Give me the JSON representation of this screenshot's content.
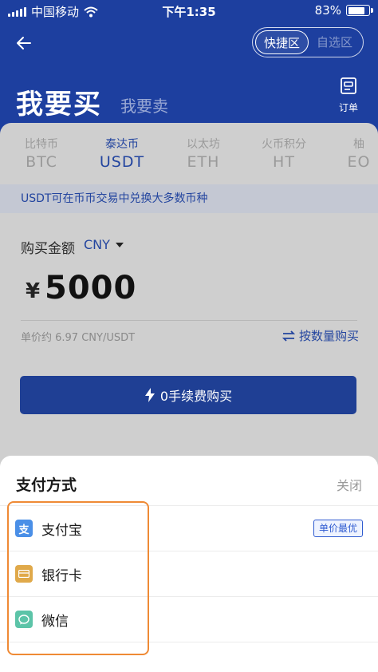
{
  "status_bar": {
    "carrier": "中国移动",
    "time": "下午1:35",
    "battery": "83%"
  },
  "header": {
    "toggle": {
      "active": "快捷区",
      "inactive": "自选区"
    },
    "buy_title": "我要买",
    "sell_title": "我要卖",
    "orders_label": "订单"
  },
  "tabs": [
    {
      "cn": "比特币",
      "code": "BTC"
    },
    {
      "cn": "泰达币",
      "code": "USDT"
    },
    {
      "cn": "以太坊",
      "code": "ETH"
    },
    {
      "cn": "火币积分",
      "code": "HT"
    },
    {
      "cn": "柚",
      "code": "EO"
    }
  ],
  "info_text": "USDT可在币币交易中兑换大多数币种",
  "purchase": {
    "amount_label": "购买金额",
    "currency": "CNY",
    "yen_symbol": "¥",
    "amount": "5000",
    "unit_price": "单价约 6.97 CNY/USDT",
    "by_quantity": "按数量购买",
    "buy_button": "0手续费购买"
  },
  "payment_sheet": {
    "title": "支付方式",
    "close": "关闭",
    "methods": [
      {
        "name": "支付宝",
        "icon_char": "支",
        "badge": "单价最优"
      },
      {
        "name": "银行卡"
      },
      {
        "name": "微信"
      }
    ]
  },
  "colors": {
    "brand_blue": "#1d3f9f",
    "alipay": "#4a8fe7",
    "bank": "#e0a94a",
    "wechat": "#5cc4a8",
    "highlight": "#ef8a35"
  }
}
